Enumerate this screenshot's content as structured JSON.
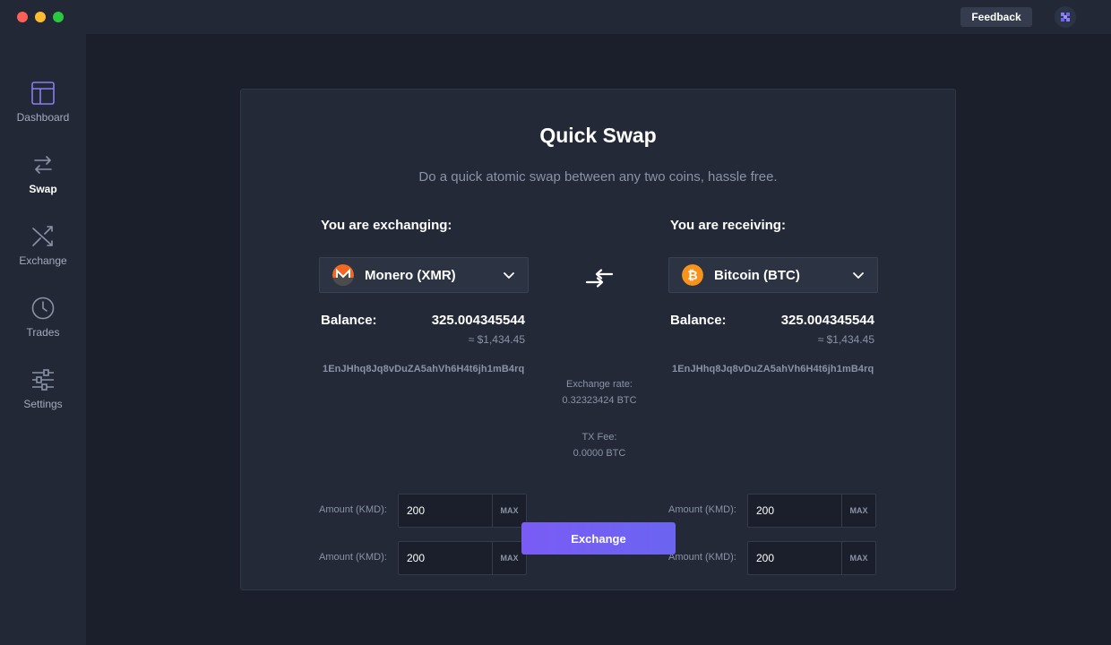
{
  "window": {
    "feedback_label": "Feedback"
  },
  "sidebar": {
    "items": [
      {
        "label": "Dashboard",
        "icon": "dashboard-icon",
        "active": false
      },
      {
        "label": "Swap",
        "icon": "swap-icon",
        "active": true
      },
      {
        "label": "Exchange",
        "icon": "exchange-icon",
        "active": false
      },
      {
        "label": "Trades",
        "icon": "clock-icon",
        "active": false
      },
      {
        "label": "Settings",
        "icon": "sliders-icon",
        "active": false
      }
    ]
  },
  "swap": {
    "title": "Quick Swap",
    "subtitle": "Do a quick atomic swap between any two coins, hassle free.",
    "left": {
      "heading": "You are exchanging:",
      "coin": "Monero (XMR)",
      "coin_icon": "monero-icon",
      "coin_color": "#f26822",
      "balance_label": "Balance:",
      "balance_value": "325.004345544",
      "balance_usd": "≈ $1,434.45",
      "address": "1EnJHhq8Jq8vDuZA5ahVh6H4t6jh1mB4rq",
      "amounts": [
        {
          "label": "Amount (KMD):",
          "value": "200",
          "max_label": "MAX"
        },
        {
          "label": "Amount (KMD):",
          "value": "200",
          "max_label": "MAX"
        }
      ]
    },
    "right": {
      "heading": "You are receiving:",
      "coin": "Bitcoin (BTC)",
      "coin_icon": "bitcoin-icon",
      "coin_color": "#f7931a",
      "balance_label": "Balance:",
      "balance_value": "325.004345544",
      "balance_usd": "≈ $1,434.45",
      "address": "1EnJHhq8Jq8vDuZA5ahVh6H4t6jh1mB4rq",
      "amounts": [
        {
          "label": "Amount (KMD):",
          "value": "200",
          "max_label": "MAX"
        },
        {
          "label": "Amount (KMD):",
          "value": "200",
          "max_label": "MAX"
        }
      ]
    },
    "exchange_rate_label": "Exchange rate:",
    "exchange_rate_value": "0.32323424 BTC",
    "tx_fee_label": "TX Fee:",
    "tx_fee_value": "0.0000 BTC",
    "exchange_button": "Exchange"
  },
  "colors": {
    "accent": "#7a5cf5",
    "background": "#1a1f2b",
    "panel": "#232937",
    "sidebar_icon": "#8a7cf0"
  }
}
